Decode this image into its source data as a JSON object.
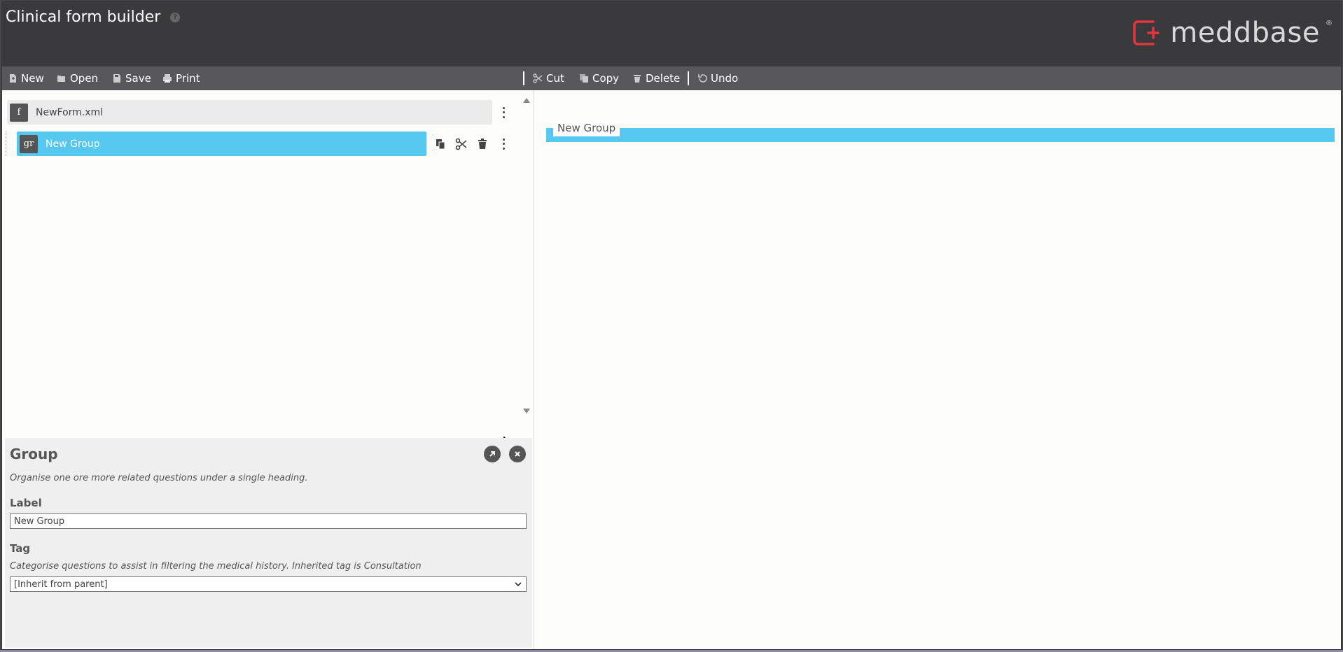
{
  "header": {
    "title": "Clinical form builder",
    "help_glyph": "?",
    "logo": "meddbase",
    "logo_mark": "®",
    "logo_color": "#e4343f"
  },
  "toolbar": {
    "file": [
      {
        "label": "New",
        "icon": "new-file-icon"
      },
      {
        "label": "Open",
        "icon": "folder-open-icon"
      },
      {
        "label": "Save",
        "icon": "save-icon"
      },
      {
        "label": "Print",
        "icon": "print-icon"
      }
    ],
    "edit": [
      {
        "label": "Cut",
        "icon": "cut-icon"
      },
      {
        "label": "Copy",
        "icon": "copy-icon"
      },
      {
        "label": "Delete",
        "icon": "trash-icon"
      },
      {
        "label": "Undo",
        "icon": "undo-icon"
      }
    ]
  },
  "tree": {
    "file_node": {
      "badge": "f",
      "label": "NewForm.xml"
    },
    "group_node": {
      "badge": "gr",
      "label": "New Group",
      "selected": true
    }
  },
  "properties": {
    "title": "Group",
    "description": "Organise one ore more related questions under a single heading.",
    "label_field": {
      "label": "Label",
      "value": "New Group"
    },
    "tag_field": {
      "label": "Tag",
      "description": "Categorise questions to assist in filtering the medical history. Inherited tag is Consultation",
      "selected": "[Inherit from parent]"
    }
  },
  "preview": {
    "group_label": "New Group"
  },
  "colors": {
    "accent": "#56c8ef",
    "header": "#3a3a3c",
    "toolbar": "#58585a"
  }
}
